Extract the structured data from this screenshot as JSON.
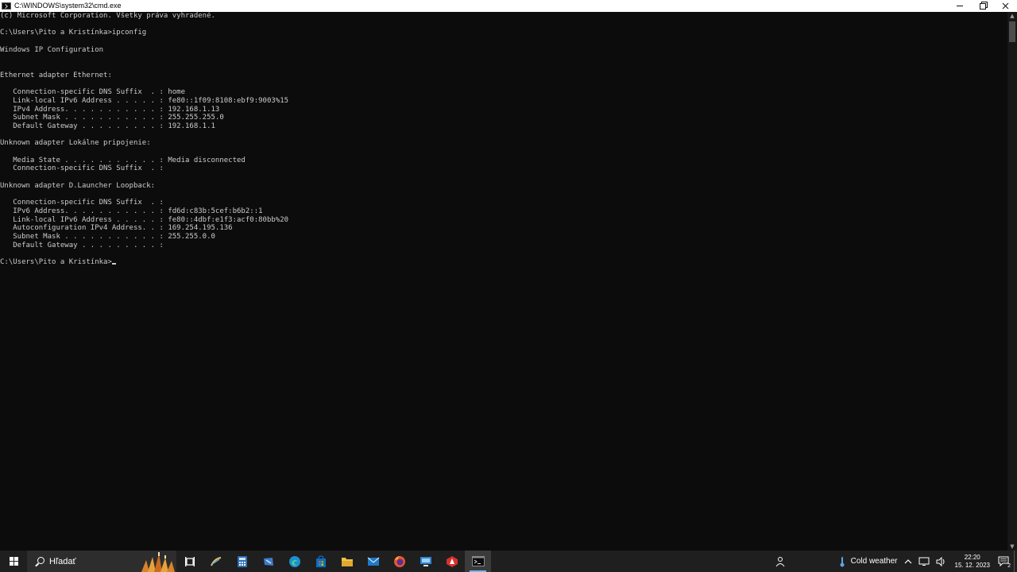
{
  "window": {
    "title": "C:\\WINDOWS\\system32\\cmd.exe",
    "controls": {
      "minimize": "minimize",
      "restore": "restore",
      "close": "close"
    }
  },
  "console": {
    "lines": [
      "(c) Microsoft Corporation. Všetky práva vyhradené.",
      "",
      "C:\\Users\\Pito a Kristínka>ipconfig",
      "",
      "Windows IP Configuration",
      "",
      "",
      "Ethernet adapter Ethernet:",
      "",
      "   Connection-specific DNS Suffix  . : home",
      "   Link-local IPv6 Address . . . . . : fe80::1f09:8108:ebf9:9003%15",
      "   IPv4 Address. . . . . . . . . . . : 192.168.1.13",
      "   Subnet Mask . . . . . . . . . . . : 255.255.255.0",
      "   Default Gateway . . . . . . . . . : 192.168.1.1",
      "",
      "Unknown adapter Lokálne pripojenie:",
      "",
      "   Media State . . . . . . . . . . . : Media disconnected",
      "   Connection-specific DNS Suffix  . :",
      "",
      "Unknown adapter D.Launcher Loopback:",
      "",
      "   Connection-specific DNS Suffix  . :",
      "   IPv6 Address. . . . . . . . . . . : fd6d:c83b:5cef:b6b2::1",
      "   Link-local IPv6 Address . . . . . : fe80::4dbf:e1f3:acf0:80bb%20",
      "   Autoconfiguration IPv4 Address. . : 169.254.195.136",
      "   Subnet Mask . . . . . . . . . . . : 255.255.0.0",
      "   Default Gateway . . . . . . . . . :",
      ""
    ],
    "prompt": "C:\\Users\\Pito a Kristínka>"
  },
  "taskbar": {
    "search_placeholder": "Hľadať",
    "apps": [
      {
        "name": "task-view-icon",
        "active": false
      },
      {
        "name": "pen-app-icon",
        "active": false
      },
      {
        "name": "calculator-icon",
        "active": false
      },
      {
        "name": "snipping-tool-icon",
        "active": false
      },
      {
        "name": "edge-icon",
        "active": false
      },
      {
        "name": "store-icon",
        "active": false
      },
      {
        "name": "file-explorer-icon",
        "active": false
      },
      {
        "name": "mail-icon",
        "active": false
      },
      {
        "name": "firefox-icon",
        "active": false
      },
      {
        "name": "remote-desktop-icon",
        "active": false
      },
      {
        "name": "red-app-icon",
        "active": false
      },
      {
        "name": "cmd-icon",
        "active": true
      }
    ],
    "weather": "Cold weather",
    "time": "22:20",
    "date": "15. 12. 2023",
    "notification_count": "2"
  },
  "colors": {
    "console_bg": "#0c0c0c",
    "console_fg": "#cccccc",
    "taskbar_bg": "#1f1f1f",
    "accent": "#7db4e6"
  }
}
